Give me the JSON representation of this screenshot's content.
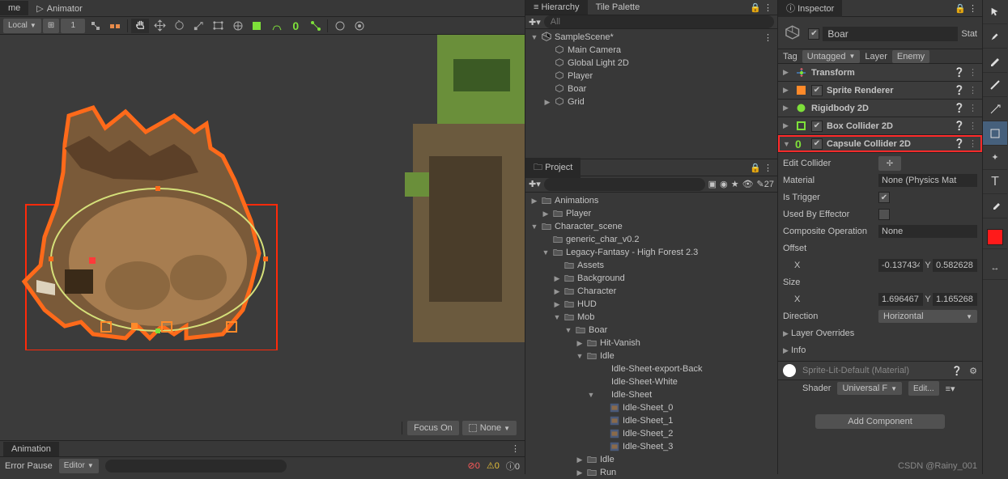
{
  "topTabs": {
    "scene": "me",
    "animator": "Animator"
  },
  "toolbar": {
    "coordDropdown": "Local",
    "numField": "1"
  },
  "focus": {
    "btn": "Focus On",
    "dropdown": "None"
  },
  "animation": {
    "title": "Animation",
    "errorPause": "Error Pause",
    "editor": "Editor",
    "badgeA": "0",
    "badgeB": "0",
    "badgeC": "0"
  },
  "hierarchy": {
    "tabs": {
      "hierarchy": "Hierarchy",
      "tilePalette": "Tile Palette"
    },
    "searchPlaceholder": "All",
    "items": [
      {
        "name": "SampleScene*",
        "depth": 0,
        "arrow": "▼",
        "icon": "unity",
        "more": true
      },
      {
        "name": "Main Camera",
        "depth": 1,
        "arrow": "",
        "icon": "cube"
      },
      {
        "name": "Global Light 2D",
        "depth": 1,
        "arrow": "",
        "icon": "cube"
      },
      {
        "name": "Player",
        "depth": 1,
        "arrow": "",
        "icon": "cube"
      },
      {
        "name": "Boar",
        "depth": 1,
        "arrow": "",
        "icon": "cube"
      },
      {
        "name": "Grid",
        "depth": 1,
        "arrow": "▶",
        "icon": "cube"
      }
    ]
  },
  "project": {
    "tab": "Project",
    "visibility": "27",
    "items": [
      {
        "name": "Animations",
        "depth": 0,
        "arrow": "▶",
        "icon": "folder"
      },
      {
        "name": "Player",
        "depth": 1,
        "arrow": "▶",
        "icon": "folder"
      },
      {
        "name": "Character_scene",
        "depth": 0,
        "arrow": "▼",
        "icon": "folder"
      },
      {
        "name": "generic_char_v0.2",
        "depth": 1,
        "arrow": "",
        "icon": "folder"
      },
      {
        "name": "Legacy-Fantasy - High Forest 2.3",
        "depth": 1,
        "arrow": "▼",
        "icon": "folder"
      },
      {
        "name": "Assets",
        "depth": 2,
        "arrow": "",
        "icon": "folder"
      },
      {
        "name": "Background",
        "depth": 2,
        "arrow": "▶",
        "icon": "folder"
      },
      {
        "name": "Character",
        "depth": 2,
        "arrow": "▶",
        "icon": "folder"
      },
      {
        "name": "HUD",
        "depth": 2,
        "arrow": "▶",
        "icon": "folder"
      },
      {
        "name": "Mob",
        "depth": 2,
        "arrow": "▼",
        "icon": "folder"
      },
      {
        "name": "Boar",
        "depth": 3,
        "arrow": "▼",
        "icon": "folder"
      },
      {
        "name": "Hit-Vanish",
        "depth": 4,
        "arrow": "▶",
        "icon": "folder"
      },
      {
        "name": "Idle",
        "depth": 4,
        "arrow": "▼",
        "icon": "folder"
      },
      {
        "name": "Idle-Sheet-export-Back",
        "depth": 5,
        "arrow": "",
        "icon": ""
      },
      {
        "name": "Idle-Sheet-White",
        "depth": 5,
        "arrow": "",
        "icon": ""
      },
      {
        "name": "Idle-Sheet",
        "depth": 5,
        "arrow": "▼",
        "icon": ""
      },
      {
        "name": "Idle-Sheet_0",
        "depth": 6,
        "arrow": "",
        "icon": "sprite"
      },
      {
        "name": "Idle-Sheet_1",
        "depth": 6,
        "arrow": "",
        "icon": "sprite"
      },
      {
        "name": "Idle-Sheet_2",
        "depth": 6,
        "arrow": "",
        "icon": "sprite"
      },
      {
        "name": "Idle-Sheet_3",
        "depth": 6,
        "arrow": "",
        "icon": "sprite"
      },
      {
        "name": "Idle",
        "depth": 4,
        "arrow": "▶",
        "icon": "folder"
      },
      {
        "name": "Run",
        "depth": 4,
        "arrow": "▶",
        "icon": "folder"
      }
    ]
  },
  "inspector": {
    "tab": "Inspector",
    "objectName": "Boar",
    "staticLabel": "Stat",
    "tagLabel": "Tag",
    "tagValue": "Untagged",
    "layerLabel": "Layer",
    "layerValue": "Enemy",
    "components": [
      {
        "title": "Transform",
        "icon": "transform",
        "color": "#e88b4a",
        "expanded": false,
        "checkbox": false
      },
      {
        "title": "Sprite Renderer",
        "icon": "sprite",
        "color": "#ff8a2a",
        "expanded": false,
        "checkbox": true
      },
      {
        "title": "Rigidbody 2D",
        "icon": "rigid",
        "color": "#7ee03a",
        "expanded": false,
        "checkbox": false
      },
      {
        "title": "Box Collider 2D",
        "icon": "box",
        "color": "#7ee03a",
        "expanded": false,
        "checkbox": true
      },
      {
        "title": "Capsule Collider 2D",
        "icon": "capsule",
        "color": "#7ee03a",
        "expanded": true,
        "checkbox": true,
        "highlighted": true
      }
    ],
    "capsule": {
      "editColliderLabel": "Edit Collider",
      "materialLabel": "Material",
      "materialValue": "None (Physics Mat",
      "isTriggerLabel": "Is Trigger",
      "isTriggerValue": true,
      "usedByEffectorLabel": "Used By Effector",
      "compositeLabel": "Composite Operation",
      "compositeValue": "None",
      "offsetLabel": "Offset",
      "offsetX": "-0.1374341",
      "offsetY": "0.582628",
      "sizeLabel": "Size",
      "sizeX": "1.696467",
      "sizeY": "1.165268",
      "directionLabel": "Direction",
      "directionValue": "Horizontal",
      "layerOverridesLabel": "Layer Overrides",
      "infoLabel": "Info"
    },
    "material": {
      "name": "Sprite-Lit-Default (Material)",
      "shaderLabel": "Shader",
      "shaderValue": "Universal F",
      "editBtn": "Edit..."
    },
    "addComponent": "Add Component"
  },
  "watermark": "CSDN @Rainy_001"
}
